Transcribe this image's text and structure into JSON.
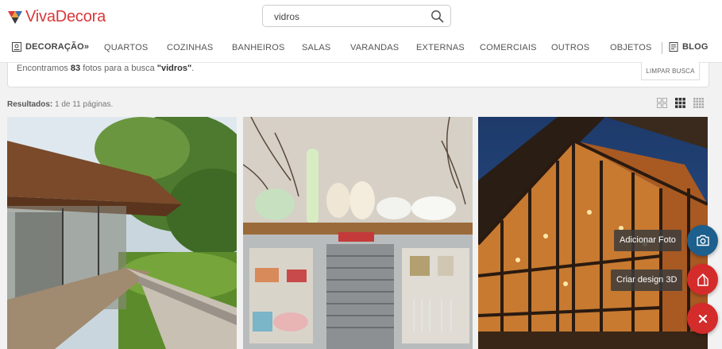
{
  "brand": {
    "name": "VivaDecora"
  },
  "search": {
    "value": "vidros",
    "placeholder": ""
  },
  "nav": {
    "decoracao": "DECORAÇÃO»",
    "items": [
      "QUARTOS",
      "COZINHAS",
      "BANHEIROS",
      "SALAS",
      "VARANDAS",
      "EXTERNAS",
      "COMERCIAIS",
      "OUTROS",
      "OBJETOS"
    ],
    "blog": "BLOG"
  },
  "result": {
    "prefix": "Encontramos",
    "count": "83",
    "middle": "fotos para a busca",
    "query": "\"vidros\"",
    "suffix": ".",
    "clear_label": "LIMPAR BUSCA"
  },
  "pagination": {
    "label": "Resultados:",
    "text": "1 de 11 páginas."
  },
  "fabs": {
    "add_photo": "Adicionar Foto",
    "design_3d": "Criar design 3D",
    "colors": {
      "blue": "#1d5f8d",
      "red": "#d42b2b"
    }
  },
  "colors": {
    "brand": "#d9383a"
  }
}
